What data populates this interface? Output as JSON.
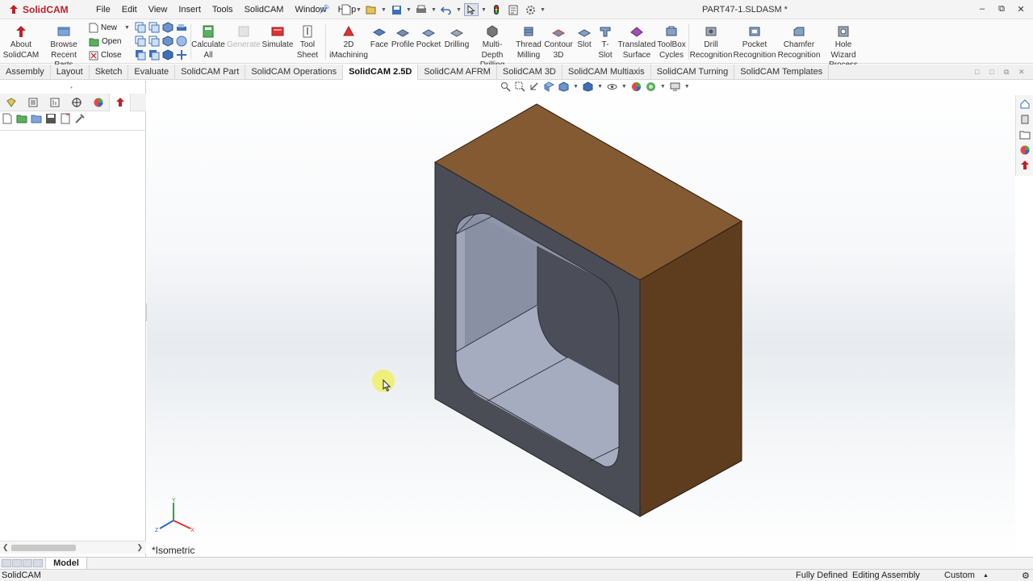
{
  "app": {
    "brand": "SolidCAM",
    "document_title": "PART47-1.SLDASM *"
  },
  "menu": [
    "File",
    "Edit",
    "View",
    "Insert",
    "Tools",
    "SolidCAM",
    "Window",
    "Help"
  ],
  "ribbon": {
    "about": "About\nSolidCAM",
    "browse": "Browse\nRecent Parts",
    "new": "New",
    "open": "Open",
    "close": "Close",
    "calculate": "Calculate\nAll",
    "generate": "Generate",
    "simulate": "Simulate",
    "tool_sheet": "Tool\nSheet",
    "imachining": "2D\niMachining",
    "face": "Face",
    "profile": "Profile",
    "pocket": "Pocket",
    "drilling": "Drilling",
    "multi_depth": "Multi-Depth\nDrilling",
    "thread": "Thread\nMilling",
    "contour3d": "Contour\n3D",
    "slot": "Slot",
    "tslot": "T-Slot",
    "translated": "Translated\nSurface",
    "toolbox": "ToolBox\nCycles",
    "drill_rec": "Drill\nRecognition",
    "pocket_rec": "Pocket\nRecognition",
    "chamfer_rec": "Chamfer\nRecognition",
    "hole_wizard": "Hole Wizard\nProcess"
  },
  "tabs": [
    "Assembly",
    "Layout",
    "Sketch",
    "Evaluate",
    "SolidCAM Part",
    "SolidCAM Operations",
    "SolidCAM 2.5D",
    "SolidCAM AFRM",
    "SolidCAM 3D",
    "SolidCAM Multiaxis",
    "SolidCAM Turning",
    "SolidCAM Templates"
  ],
  "active_tab": "SolidCAM 2.5D",
  "viewport": {
    "view_label": "*Isometric"
  },
  "bottom": {
    "model_tab": "Model"
  },
  "status": {
    "app": "SolidCAM",
    "defined": "Fully Defined",
    "mode": "Editing Assembly",
    "units": "Custom"
  },
  "colors": {
    "accent": "#c0202a",
    "wood_top": "#845a33",
    "wood_side": "#5e3d1e",
    "frame": "#4a4d56",
    "cavity_light": "#9aa1b5"
  }
}
